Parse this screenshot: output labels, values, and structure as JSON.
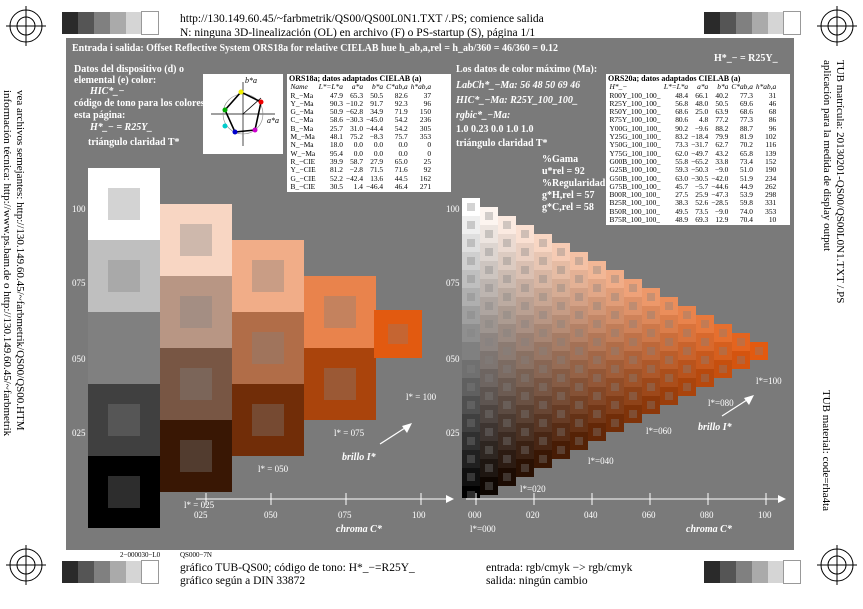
{
  "header": {
    "line1": "http://130.149.60.45/~farbmetrik/QS00/QS00L0N1.TXT /.PS; comience salida",
    "line2": "N: ninguna 3D-linealización (OL) en archivo (F) o PS-startup (S), página 1/1"
  },
  "side_left": {
    "line1": "vea archivos semejantes: http://130.149.60.45/~farbmetrik/QS00/QS00.HTM",
    "line2": "información técnica: http://www.ps.bam.de o http://130.149.60.45/~farbmetrik"
  },
  "side_right": {
    "line1": "TUB matrícula: 20130201-QS00/QS00L0N1.TXT /.PS",
    "line2": "aplicación para la medida de display output",
    "line3": "TUB material: code=rha4ta"
  },
  "panel": {
    "title": "Entrada i salida: Offset Reflective System ORS18a for relative CIELAB hue h_ab,a,rel = h_ab/360 = 46/360 = 0.12",
    "hue_label": "H*_− = R25Y_",
    "left_heading1": "Datos del dispositivo (d) o",
    "left_heading2": "elemental (e) color:",
    "hic_label": "HIC*_−",
    "hue_code_label1": "código de tono para los colores",
    "hue_code_label2": "esta página:",
    "hue_code_value": "H*_− = R25Y_",
    "triangle_label": "triángulo claridad T*",
    "right_heading": "Los datos de color máximo (Ma):",
    "labch_line": "LabCh*_−Ma: 56  48  50  69  46",
    "hic_ma_line": "HIC*_−Ma: R25Y_100_100_",
    "rgbic_label": "rgbic*_−Ma:",
    "rgbic_values": "1.0  0.23  0.0  1.0  1.0",
    "triangle_label_right": "triángulo claridad T*",
    "gamut": "%Gama",
    "urel": "u*rel = 92",
    "regularity": "%Regularidad",
    "ghrel": "g*H,rel = 57",
    "gcrel": "g*C,rel = 58",
    "brillo_left": "brillo I*",
    "brillo_right": "brillo I*",
    "chroma_left": "chroma C*",
    "chroma_right": "chroma C*",
    "left_y_ticks": [
      "100",
      "075",
      "050",
      "025"
    ],
    "left_x_ticks": [
      "025",
      "050",
      "075",
      "100"
    ],
    "left_iso": [
      "l* = 100",
      "l* = 075",
      "l* = 050",
      "l* = 025"
    ],
    "right_y_ticks": [
      "100",
      "075",
      "050",
      "025"
    ],
    "right_x_ticks": [
      "000",
      "020",
      "040",
      "060",
      "080",
      "100"
    ],
    "right_iso": [
      "l*=100",
      "l*=080",
      "l*=060",
      "l*=040",
      "l*=020",
      "l*=000"
    ],
    "hue_circle": {
      "b_label": "b*a",
      "a_label": "a*a"
    }
  },
  "table_left": {
    "title": "ORS18a; datos adaptados CIELAB (a)",
    "headers": [
      "Name",
      "L*=L*a",
      "a*a",
      "b*a",
      "C*ab,a",
      "h*ab,a"
    ],
    "rows": [
      [
        "R_−Ma",
        "47.9",
        "65.3",
        "50.5",
        "82.6",
        "37"
      ],
      [
        "Y_−Ma",
        "90.3",
        "−10.2",
        "91.7",
        "92.3",
        "96"
      ],
      [
        "G_−Ma",
        "50.9",
        "−62.8",
        "34.9",
        "71.9",
        "150"
      ],
      [
        "C_−Ma",
        "58.6",
        "−30.3",
        "−45.0",
        "54.2",
        "236"
      ],
      [
        "B_−Ma",
        "25.7",
        "31.0",
        "−44.4",
        "54.2",
        "305"
      ],
      [
        "M_−Ma",
        "48.1",
        "75.2",
        "−8.3",
        "75.7",
        "353"
      ],
      [
        "N_−Ma",
        "18.0",
        "0.0",
        "0.0",
        "0.0",
        "0"
      ],
      [
        "W_−Ma",
        "95.4",
        "0.0",
        "0.0",
        "0.0",
        "0"
      ],
      [
        "R_−CIE",
        "39.9",
        "58.7",
        "27.9",
        "65.0",
        "25"
      ],
      [
        "Y_−CIE",
        "81.2",
        "−2.8",
        "71.5",
        "71.6",
        "92"
      ],
      [
        "G_−CIE",
        "52.2",
        "−42.4",
        "13.6",
        "44.5",
        "162"
      ],
      [
        "B_−CIE",
        "30.5",
        "1.4",
        "−46.4",
        "46.4",
        "271"
      ]
    ]
  },
  "table_right": {
    "title": "ORS20a; datos adaptados CIELAB (a)",
    "headers": [
      "H*_−",
      "L*=L*a",
      "a*a",
      "b*a",
      "C*ab,a",
      "h*ab,a"
    ],
    "rows": [
      [
        "R00Y_100_100_",
        "48.4",
        "66.1",
        "40.2",
        "77.3",
        "31"
      ],
      [
        "R25Y_100_100_",
        "56.8",
        "48.0",
        "50.5",
        "69.6",
        "46"
      ],
      [
        "R50Y_100_100_",
        "68.6",
        "25.0",
        "63.9",
        "68.6",
        "68"
      ],
      [
        "R75Y_100_100_",
        "80.6",
        "4.8",
        "77.2",
        "77.3",
        "86"
      ],
      [
        "Y00G_100_100_",
        "90.2",
        "−9.6",
        "88.2",
        "88.7",
        "96"
      ],
      [
        "Y25G_100_100_",
        "83.2",
        "−18.4",
        "79.9",
        "81.9",
        "102"
      ],
      [
        "Y50G_100_100_",
        "73.3",
        "−31.7",
        "62.7",
        "70.2",
        "116"
      ],
      [
        "Y75G_100_100_",
        "62.0",
        "−49.7",
        "43.2",
        "65.8",
        "139"
      ],
      [
        "G00B_100_100_",
        "55.8",
        "−65.2",
        "33.8",
        "73.4",
        "152"
      ],
      [
        "G25B_100_100_",
        "59.3",
        "−50.3",
        "−9.0",
        "51.0",
        "190"
      ],
      [
        "G50B_100_100_",
        "63.0",
        "−30.5",
        "−42.0",
        "51.9",
        "234"
      ],
      [
        "G75B_100_100_",
        "45.7",
        "−5.7",
        "−44.6",
        "44.9",
        "262"
      ],
      [
        "B00R_100_100_",
        "27.5",
        "25.9",
        "−47.3",
        "53.9",
        "298"
      ],
      [
        "B25R_100_100_",
        "38.3",
        "52.6",
        "−28.5",
        "59.8",
        "331"
      ],
      [
        "B50R_100_100_",
        "49.5",
        "73.5",
        "−9.0",
        "74.0",
        "353"
      ],
      [
        "B75R_100_100_",
        "48.9",
        "69.3",
        "12.9",
        "70.4",
        "10"
      ]
    ]
  },
  "bottom": {
    "code_left": "2−000030−L0",
    "code_mid": "QS000−7N",
    "left_line1": "gráfico TUB-QS00; código de tono: H*_−=R25Y_",
    "left_line2": "gráfico según a DIN 33872",
    "right_line1": "entrada: rgb/cmyk −> rgb/cmyk",
    "right_line2": "salida: ningún cambio"
  },
  "colors": {
    "panel_gray": "#7a7a7a",
    "max_color": "#e25a10",
    "strip": [
      "#2a2a2a",
      "#555555",
      "#808080",
      "#aaaaaa",
      "#d5d5d5",
      "#ffffff"
    ]
  }
}
